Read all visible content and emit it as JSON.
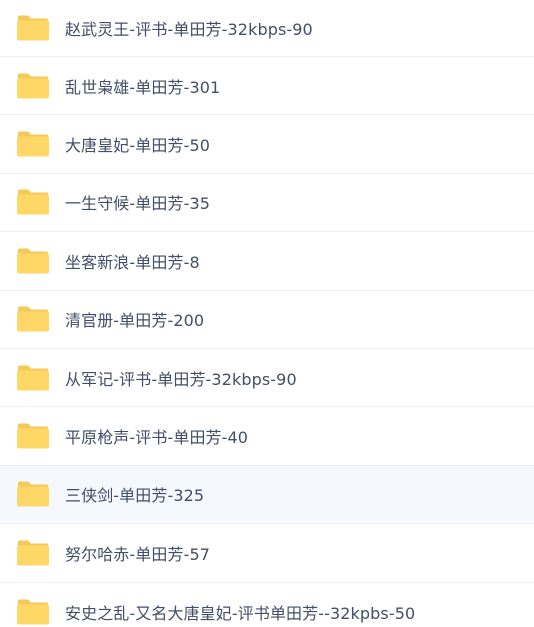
{
  "colors": {
    "folder_back": "#f5c85a",
    "folder_front": "#ffd766",
    "text": "#424e67",
    "divider": "#eef1f5",
    "selected_bg": "#f5f9ff"
  },
  "items": [
    {
      "name": "赵武灵王-评书-单田芳-32kbps-90",
      "icon": "folder-icon"
    },
    {
      "name": "乱世枭雄-单田芳-301",
      "icon": "folder-icon"
    },
    {
      "name": "大唐皇妃-单田芳-50",
      "icon": "folder-icon"
    },
    {
      "name": "一生守候-单田芳-35",
      "icon": "folder-icon"
    },
    {
      "name": "坐客新浪-单田芳-8",
      "icon": "folder-icon"
    },
    {
      "name": "清官册-单田芳-200",
      "icon": "folder-icon"
    },
    {
      "name": "从军记-评书-单田芳-32kbps-90",
      "icon": "folder-icon"
    },
    {
      "name": "平原枪声-评书-单田芳-40",
      "icon": "folder-icon"
    },
    {
      "name": "三侠剑-单田芳-325",
      "icon": "folder-icon"
    },
    {
      "name": "努尔哈赤-单田芳-57",
      "icon": "folder-icon"
    },
    {
      "name": "安史之乱-又名大唐皇妃-评书单田芳--32kpbs-50",
      "icon": "folder-icon"
    }
  ]
}
